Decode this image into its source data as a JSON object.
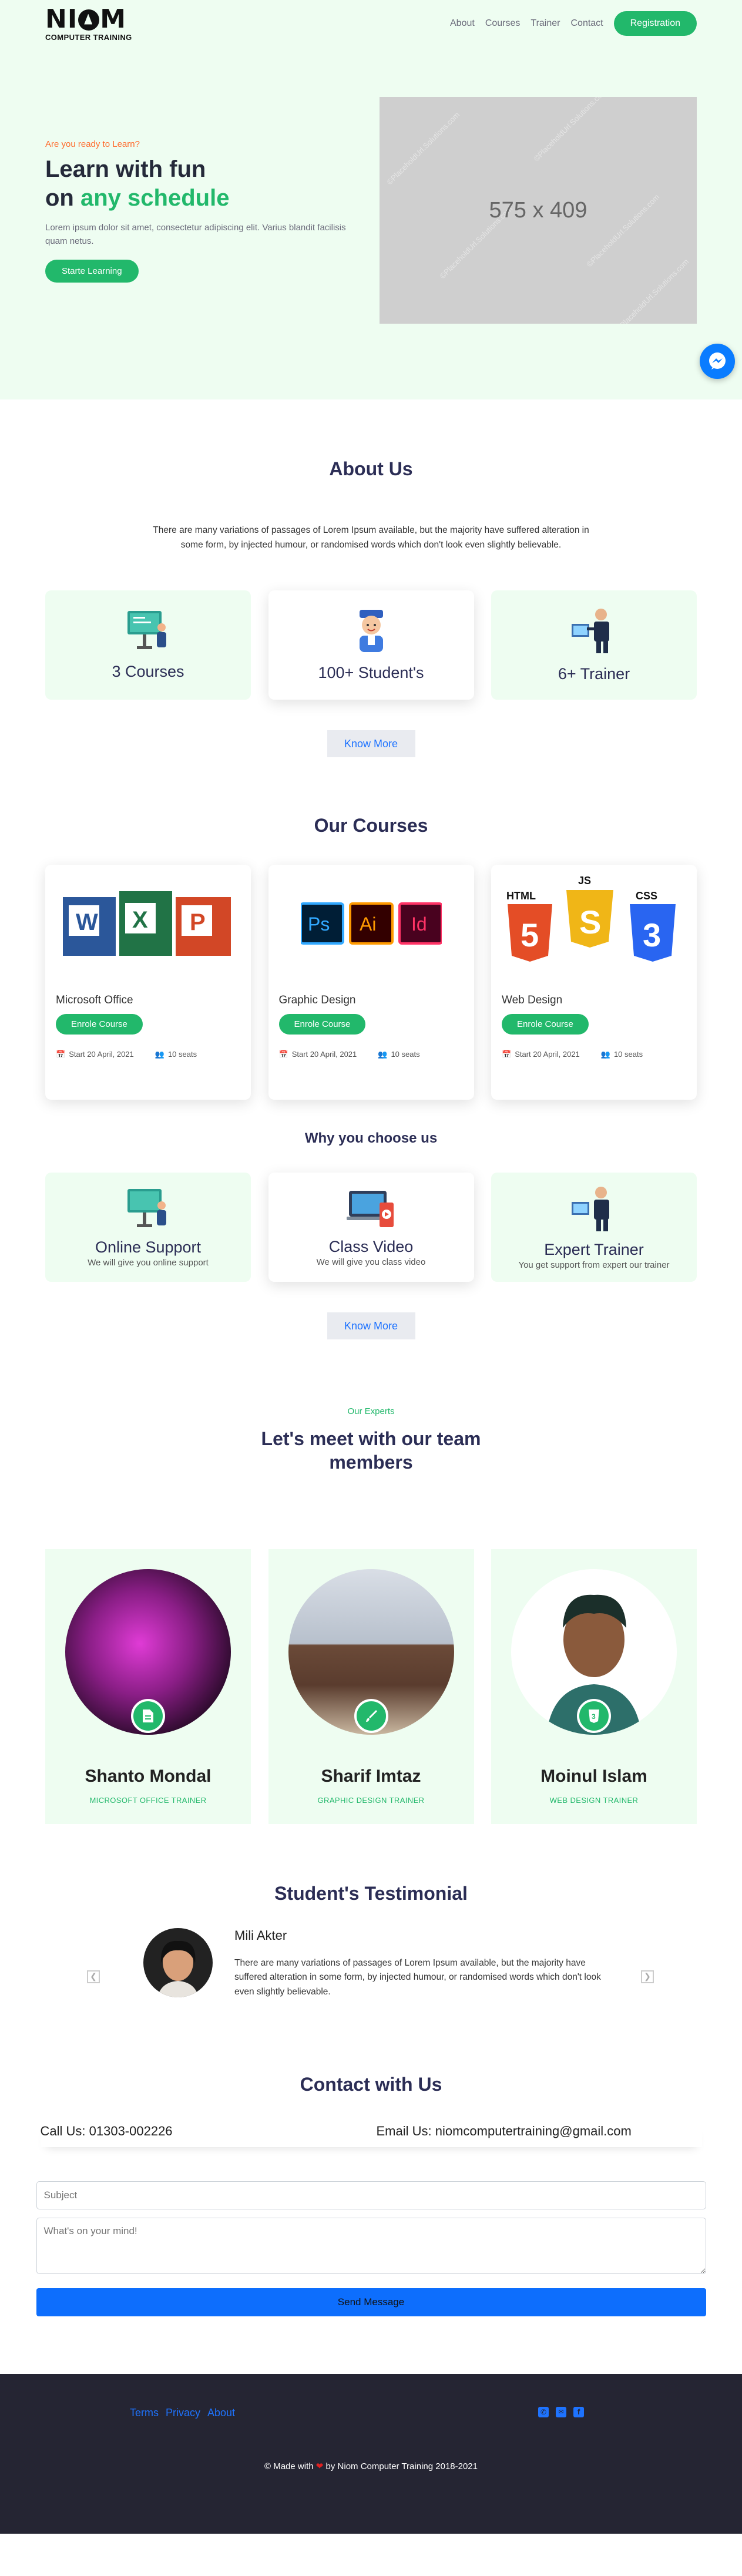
{
  "nav": {
    "logo_text": "NIOM",
    "logo_sub": "COMPUTER TRAINING",
    "links": [
      "About",
      "Courses",
      "Trainer",
      "Contact"
    ],
    "register": "Registration"
  },
  "hero": {
    "eyebrow": "Are you ready to Learn?",
    "title_line1": "Learn with fun",
    "title_on": "on",
    "title_accent": "any schedule",
    "desc": "Lorem ipsum dolor sit amet, consectetur adipiscing elit. Varius blandit facilisis quam netus.",
    "cta": "Starte Learning",
    "image_label": "575 x 409",
    "watermark": "©PlaceholdUrl.Solutions.com"
  },
  "about": {
    "title": "About Us",
    "text": "There are many variations of passages of Lorem Ipsum available, but the majority have suffered alteration in some form, by injected humour, or randomised words which don't look even slightly believable.",
    "stats": [
      "3 Courses",
      "100+ Student's",
      "6+ Trainer"
    ],
    "more": "Know More"
  },
  "courses": {
    "title": "Our Courses",
    "enrol": "Enrole Course",
    "date": "Start 20 April, 2021",
    "seats": "10 seats",
    "items": [
      {
        "name": "Microsoft Office",
        "icon": "ms-office-icon"
      },
      {
        "name": "Graphic Design",
        "icon": "adobe-icon"
      },
      {
        "name": "Web Design",
        "icon": "html-css-js-icon"
      }
    ]
  },
  "why": {
    "title": "Why you choose us",
    "items": [
      {
        "title": "Online Support",
        "desc": "We will give you online support"
      },
      {
        "title": "Class Video",
        "desc": "We will give you class video"
      },
      {
        "title": "Expert Trainer",
        "desc": "You get support from expert our trainer"
      }
    ],
    "more": "Know More"
  },
  "team": {
    "eyebrow": "Our Experts",
    "title": "Let's meet with our team members",
    "members": [
      {
        "name": "Shanto Mondal",
        "role": "MICROSOFT OFFICE TRAINER"
      },
      {
        "name": "Sharif Imtaz",
        "role": "GRAPHIC DESIGN TRAINER"
      },
      {
        "name": "Moinul Islam",
        "role": "WEB DESIGN TRAINER"
      }
    ]
  },
  "testimonial": {
    "title": "Student's Testimonial",
    "name": "Mili Akter",
    "text": "There are many variations of passages of Lorem Ipsum available, but the majority have suffered alteration in some form, by injected humour, or randomised words which don't look even slightly believable."
  },
  "contact": {
    "title": "Contact with Us",
    "phone": "Call Us: 01303-002226",
    "email": "Email Us: niomcomputertraining@gmail.com",
    "subject_placeholder": "Subject",
    "message_placeholder": "What's on your mind!",
    "send": "Send Message"
  },
  "footer": {
    "links": [
      "Terms",
      "Privacy",
      "About"
    ],
    "made_with": "© Made with",
    "made_by": "by Niom Computer Training 2018-2021"
  },
  "colors": {
    "green": "#22b86b",
    "orange": "#ff6a2b",
    "navy": "#2b2d55",
    "blue": "#1e73ff",
    "footer": "#252533"
  }
}
